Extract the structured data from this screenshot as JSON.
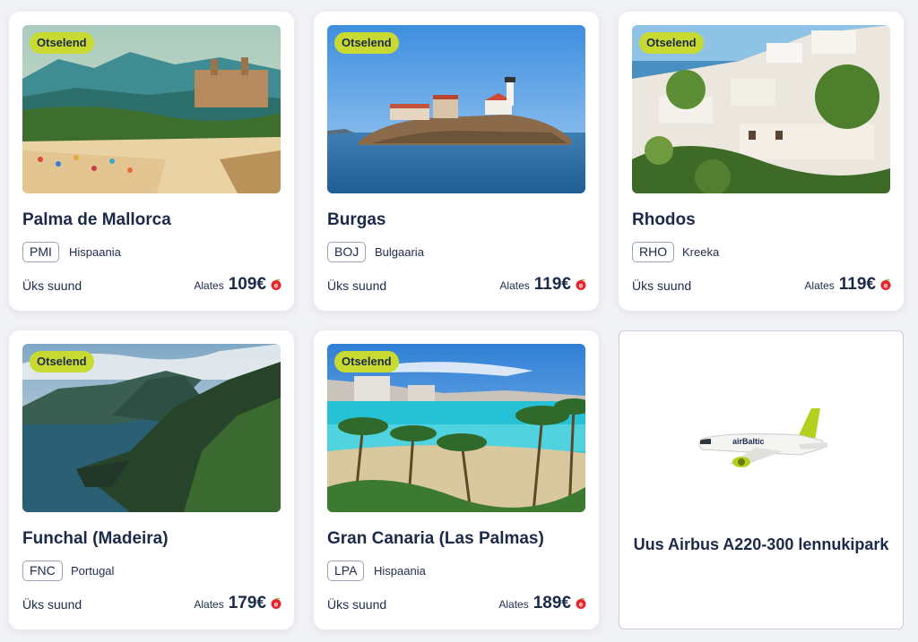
{
  "badge_label": "Otselend",
  "from_label": "Alates",
  "oneway_label": "Üks suund",
  "currency_icon": "euro-icon",
  "colors": {
    "badge": "#c8da31",
    "text": "#1c2a4a",
    "currency": "#e5262d"
  },
  "destinations": [
    {
      "city": "Palma de Mallorca",
      "code": "PMI",
      "country": "Hispaania",
      "price": "109€"
    },
    {
      "city": "Burgas",
      "code": "BOJ",
      "country": "Bulgaaria",
      "price": "119€"
    },
    {
      "city": "Rhodos",
      "code": "RHO",
      "country": "Kreeka",
      "price": "119€"
    },
    {
      "city": "Funchal (Madeira)",
      "code": "FNC",
      "country": "Portugal",
      "price": "179€"
    },
    {
      "city": "Gran Canaria (Las Palmas)",
      "code": "LPA",
      "country": "Hispaania",
      "price": "189€"
    }
  ],
  "promo": {
    "title": "Uus Airbus A220-300 lennukipark",
    "logo_text": "airBaltic"
  }
}
